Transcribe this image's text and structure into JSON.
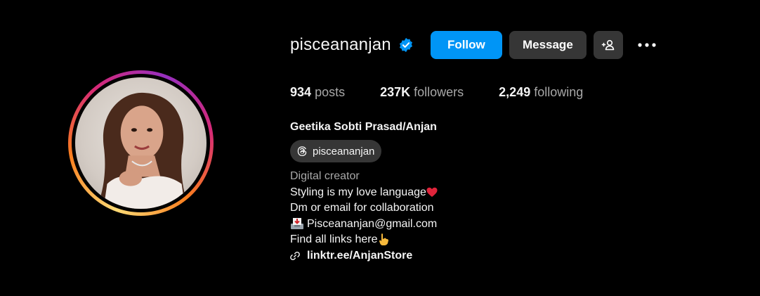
{
  "profile": {
    "username": "pisceananjan",
    "full_name": "Geetika Sobti Prasad/Anjan",
    "threads_handle": "pisceananjan",
    "category": "Digital creator",
    "bio_lines": [
      "Styling is my love language",
      "Dm or email for collaboration",
      "Pisceananjan@gmail.com",
      "Find all links here"
    ],
    "link": "linktr.ee/AnjanStore"
  },
  "actions": {
    "follow_label": "Follow",
    "message_label": "Message"
  },
  "stats": {
    "posts_count": "934",
    "posts_label": "posts",
    "followers_count": "237K",
    "followers_label": "followers",
    "following_count": "2,249",
    "following_label": "following"
  },
  "icons": {
    "verified": "verified-badge-icon",
    "add_user": "add-user-icon",
    "more": "more-options-icon",
    "threads": "threads-icon",
    "heart": "red-heart-emoji",
    "inbox": "inbox-tray-emoji",
    "point_down": "point-down-emoji",
    "link": "link-icon"
  },
  "colors": {
    "background": "#000000",
    "primary_button": "#0095f6",
    "secondary_button": "#363636",
    "muted_text": "#a8a8a8",
    "verified_blue": "#0095f6"
  }
}
